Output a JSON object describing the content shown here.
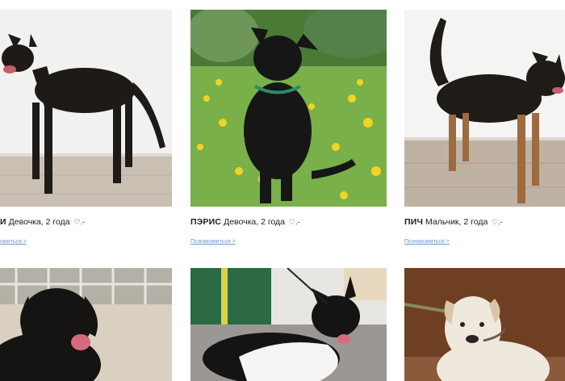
{
  "cards": [
    {
      "name": "И",
      "details": "Девочка, 2 года",
      "heart": "♡.-",
      "link": "омиться >"
    },
    {
      "name": "ПЭРИС",
      "details": "Девочка, 2 года",
      "heart": "♡.-",
      "link": "Познакомиться >"
    },
    {
      "name": "ПИЧ",
      "details": "Мальчик, 2 года",
      "heart": "♡.-",
      "link": "Познакомиться >"
    }
  ],
  "colors": {
    "link": "#6f94c4",
    "text": "#1b1b1b"
  }
}
